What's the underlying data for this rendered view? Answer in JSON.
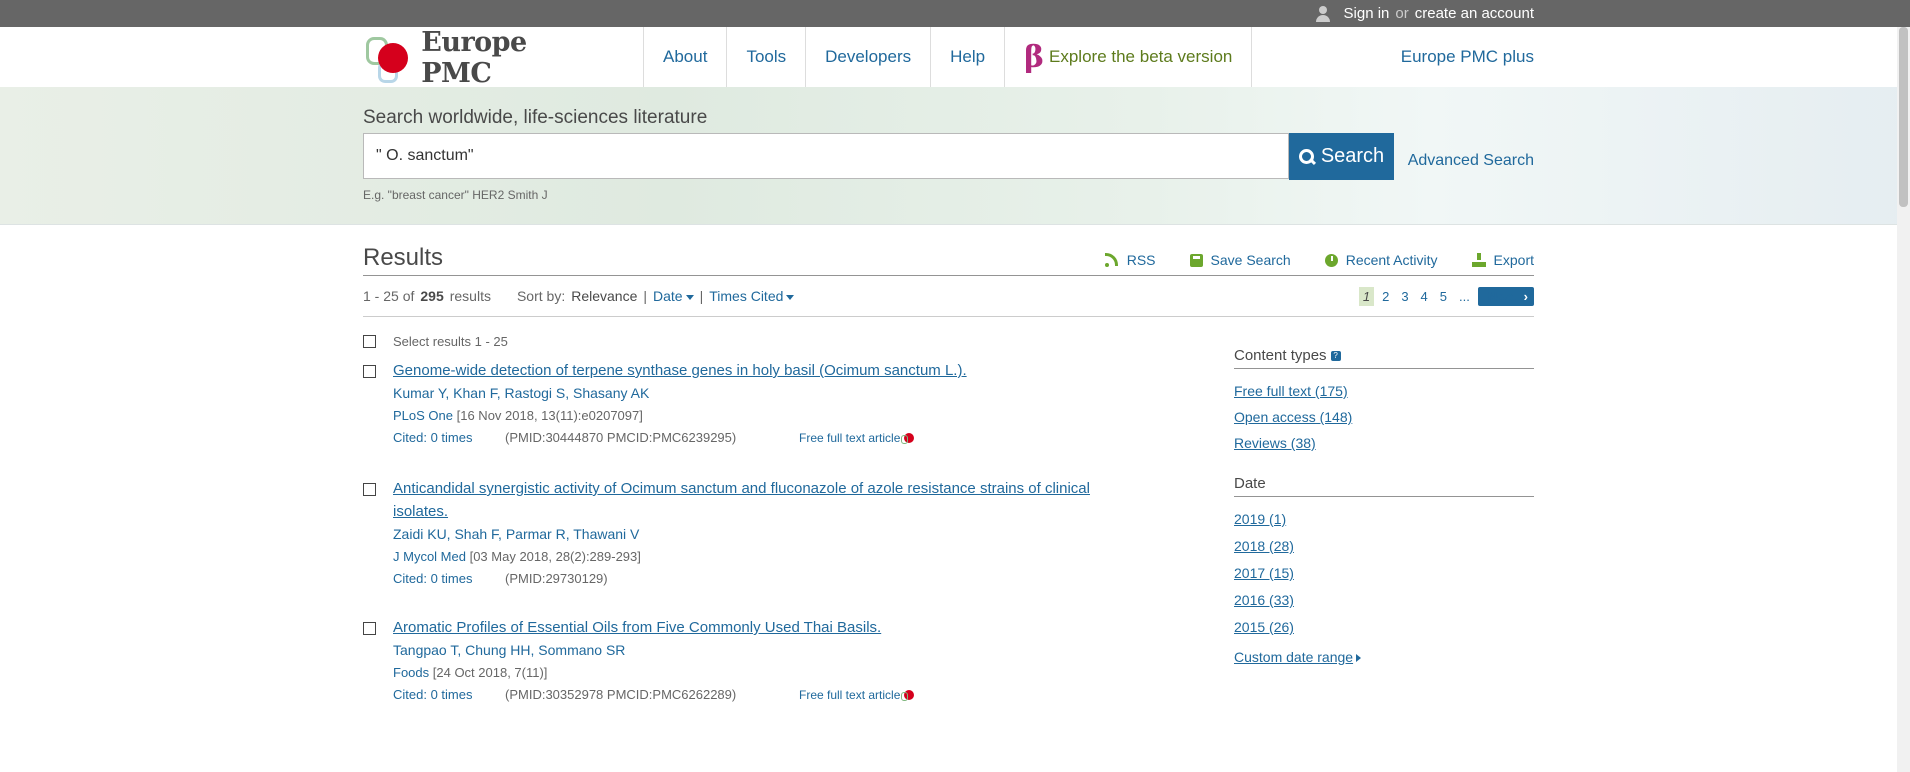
{
  "topbar": {
    "sign_in": "Sign in",
    "or": "or",
    "create_account": "create an account"
  },
  "nav": {
    "logo_text": "Europe PMC",
    "about": "About",
    "tools": "Tools",
    "developers": "Developers",
    "help": "Help",
    "beta_symbol": "β",
    "beta": "Explore the beta version",
    "plus": "Europe PMC plus"
  },
  "search": {
    "label": "Search worldwide, life-sciences literature",
    "value": "\" O. sanctum\"",
    "button": "Search",
    "advanced": "Advanced Search",
    "example": "E.g. \"breast cancer\" HER2 Smith J"
  },
  "results": {
    "title": "Results",
    "rss": "RSS",
    "save_search": "Save Search",
    "recent_activity": "Recent Activity",
    "export": "Export",
    "range": "1 - 25 of",
    "total": "295",
    "results_word": "results",
    "sort_by": "Sort by:",
    "sort_relevance": "Relevance",
    "sort_date": "Date",
    "sort_times_cited": "Times Cited",
    "pages": [
      "1",
      "2",
      "3",
      "4",
      "5",
      "..."
    ],
    "next": "Next",
    "select_all": "Select results 1 - 25",
    "items": [
      {
        "title": "Genome-wide detection of terpene synthase genes in holy basil (Ocimum sanctum L.).",
        "authors": "Kumar Y, Khan F, Rastogi S, Shasany AK",
        "journal": "PLoS One",
        "pub": "[16 Nov 2018, 13(11):e0207097]",
        "cited": "Cited: 0 times",
        "ids": "(PMID:30444870 PMCID:PMC6239295)",
        "fulltext": "Free full text article"
      },
      {
        "title": "Anticandidal synergistic activity of Ocimum sanctum and fluconazole of azole resistance strains of clinical isolates.",
        "authors": "Zaidi KU, Shah F, Parmar R, Thawani V",
        "journal": "J Mycol Med",
        "pub": "[03 May 2018, 28(2):289-293]",
        "cited": "Cited: 0 times",
        "ids": "(PMID:29730129)",
        "fulltext": ""
      },
      {
        "title": "Aromatic Profiles of Essential Oils from Five Commonly Used Thai Basils.",
        "authors": "Tangpao T, Chung HH, Sommano SR",
        "journal": "Foods",
        "pub": "[24 Oct 2018, 7(11)]",
        "cited": "Cited: 0 times",
        "ids": "(PMID:30352978 PMCID:PMC6262289)",
        "fulltext": "Free full text article"
      }
    ]
  },
  "facets": {
    "content_types": {
      "title": "Content types",
      "help": "?",
      "items": [
        "Free full text (175)",
        "Open access (148)",
        "Reviews (38)"
      ]
    },
    "date": {
      "title": "Date",
      "items": [
        "2019 (1)",
        "2018 (28)",
        "2017 (15)",
        "2016 (33)",
        "2015 (26)"
      ],
      "custom": "Custom date range"
    }
  },
  "colors": {
    "brand_blue": "#20699c",
    "brand_green": "#6ca72d",
    "logo_red": "#d5001c",
    "beta_magenta": "#b12a7e"
  },
  "icons": [
    "user-icon",
    "search-icon",
    "rss-icon",
    "save-icon",
    "clock-icon",
    "download-icon",
    "help-icon",
    "fulltext-icon",
    "caret-down-icon",
    "caret-right-icon"
  ]
}
